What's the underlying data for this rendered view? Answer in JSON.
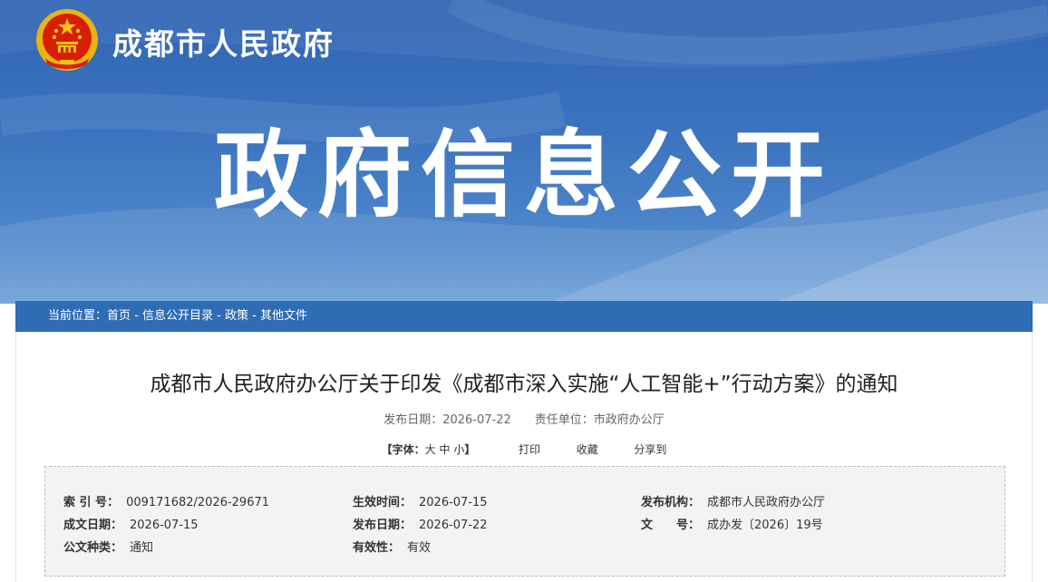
{
  "header": {
    "site_name": "成都市人民政府",
    "banner_title": "政府信息公开",
    "emblem_icon": "national-emblem-icon"
  },
  "breadcrumb": {
    "prefix": "当前位置：",
    "items": [
      "首页",
      "信息公开目录",
      "政策",
      "其他文件"
    ],
    "separator": " - "
  },
  "article": {
    "title": "成都市人民政府办公厅关于印发《成都市深入实施“人工智能+”行动方案》的通知",
    "publish_date_label": "发布日期：",
    "publish_date": "2026-07-22",
    "dept_label": "责任单位：",
    "dept": "市政府办公厅"
  },
  "tools": {
    "font_label": "【字体：",
    "size_large": "大",
    "size_medium": "中",
    "size_small": "小",
    "font_label_end": "】",
    "print": "打印",
    "favorite": "收藏",
    "share": "分享到"
  },
  "info": {
    "index_no_label": "索 引 号：",
    "index_no": "009171682/2026-29671",
    "effective_time_label": "生效时间：",
    "effective_time": "2026-07-15",
    "issuer_label": "发布机构：",
    "issuer": "成都市人民政府办公厅",
    "written_date_label": "成文日期：",
    "written_date": "2026-07-15",
    "publish_date_label": "发布日期：",
    "publish_date": "2026-07-22",
    "doc_no_label": "文　　号：",
    "doc_no": "成办发〔2026〕19号",
    "doc_type_label": "公文种类：",
    "doc_type": "通知",
    "validity_label": "有效性：",
    "validity": "有效"
  },
  "colors": {
    "banner_blue": "#2f65b3",
    "breadcrumb_blue": "#2e6db4",
    "emblem_red": "#d81e06",
    "emblem_gold": "#f5c518"
  }
}
